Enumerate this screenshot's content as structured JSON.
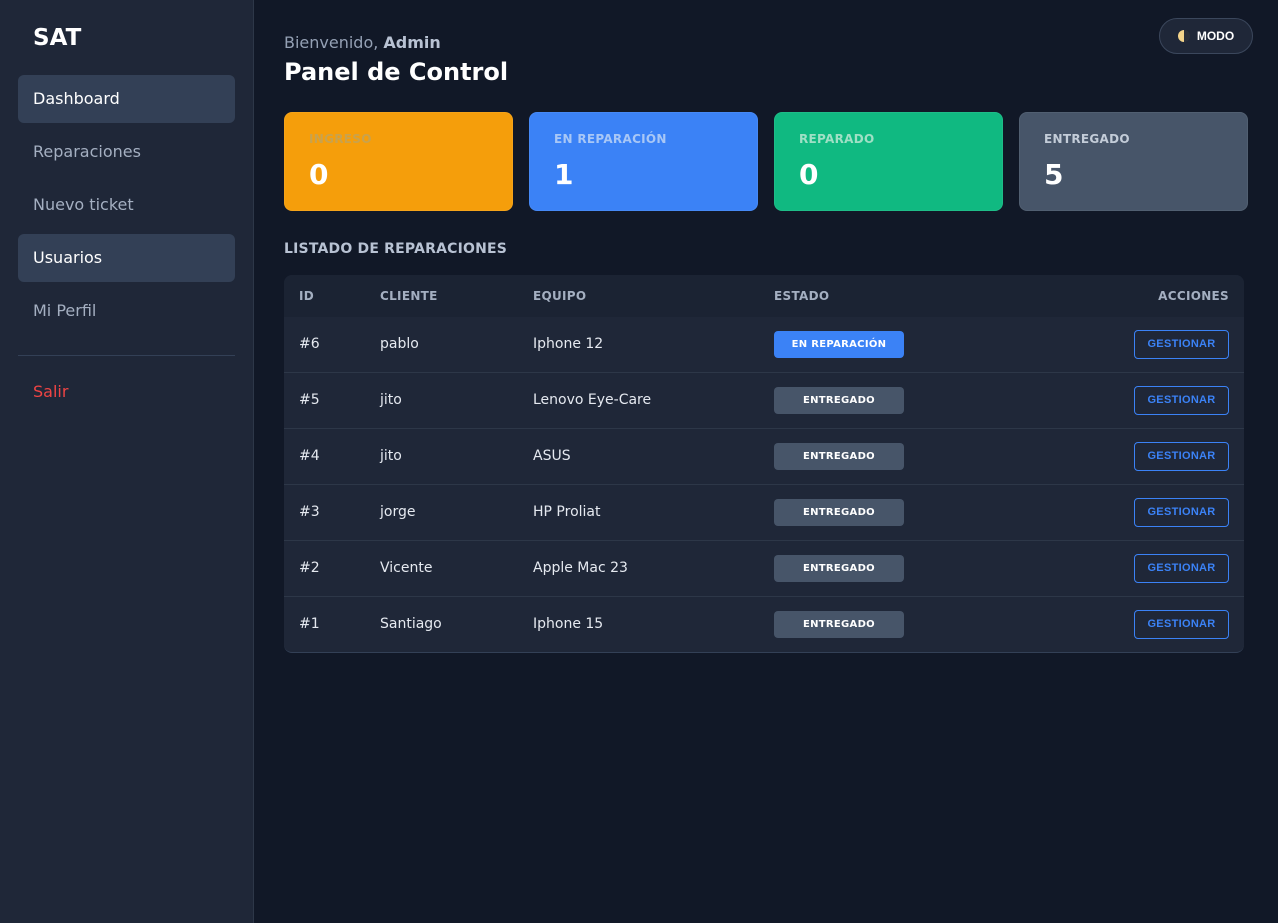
{
  "sidebar": {
    "brand": "SAT",
    "items": [
      {
        "label": "Dashboard"
      },
      {
        "label": "Reparaciones"
      },
      {
        "label": "Nuevo ticket"
      },
      {
        "label": "Usuarios"
      },
      {
        "label": "Mi Perfil"
      }
    ],
    "logout_label": "Salir"
  },
  "header": {
    "welcome_prefix": "Bienvenido, ",
    "welcome_user": "Admin",
    "title": "Panel de Control",
    "mode_label": "MODO"
  },
  "cards": [
    {
      "label": "INGRESO",
      "value": "0",
      "color": "#f59e0b"
    },
    {
      "label": "EN REPARACIÓN",
      "value": "1",
      "color": "#3b82f6"
    },
    {
      "label": "REPARADO",
      "value": "0",
      "color": "#10b981"
    },
    {
      "label": "ENTREGADO",
      "value": "5",
      "color": "#475569"
    }
  ],
  "table": {
    "title": "LISTADO DE REPARACIONES",
    "columns": [
      "ID",
      "CLIENTE",
      "EQUIPO",
      "ESTADO",
      "ACCIONES"
    ],
    "action_label": "GESTIONAR",
    "rows": [
      {
        "id": "#6",
        "cliente": "pablo",
        "equipo": "Iphone 12",
        "estado": "EN REPARACIÓN"
      },
      {
        "id": "#5",
        "cliente": "jito",
        "equipo": "Lenovo Eye-Care",
        "estado": "ENTREGADO"
      },
      {
        "id": "#4",
        "cliente": "jito",
        "equipo": "ASUS",
        "estado": "ENTREGADO"
      },
      {
        "id": "#3",
        "cliente": "jorge",
        "equipo": "HP Proliat",
        "estado": "ENTREGADO"
      },
      {
        "id": "#2",
        "cliente": "Vicente",
        "equipo": "Apple Mac 23",
        "estado": "ENTREGADO"
      },
      {
        "id": "#1",
        "cliente": "Santiago",
        "equipo": "Iphone 15",
        "estado": "ENTREGADO"
      }
    ]
  },
  "colors": {
    "accent": "#3b82f6",
    "danger": "#ef4444",
    "background": "#111827",
    "sidebar": "#1f2738"
  }
}
